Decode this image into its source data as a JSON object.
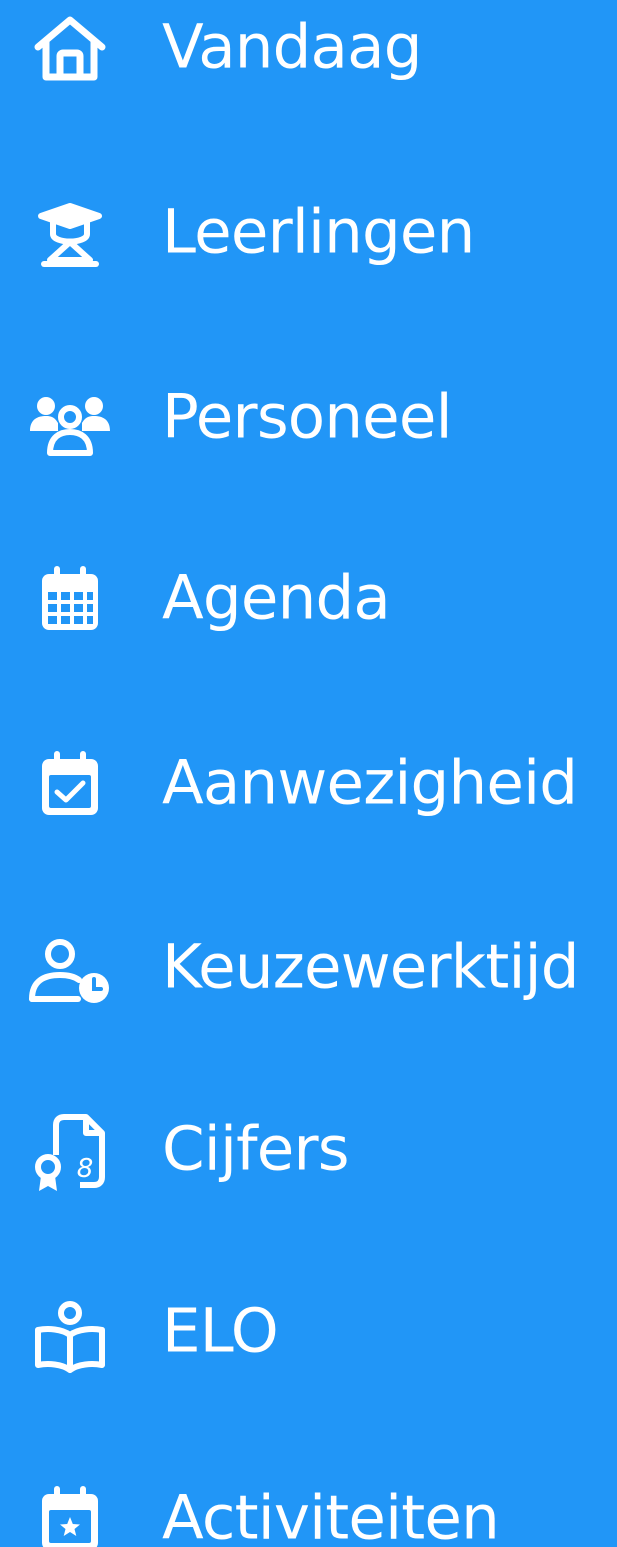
{
  "sidebar": {
    "background_color": "#2196f7",
    "text_color": "#ffffff",
    "items": [
      {
        "label": "Vandaag",
        "icon": "home-icon"
      },
      {
        "label": "Leerlingen",
        "icon": "student-graduate-icon"
      },
      {
        "label": "Personeel",
        "icon": "users-group-icon"
      },
      {
        "label": "Agenda",
        "icon": "calendar-grid-icon"
      },
      {
        "label": "Aanwezigheid",
        "icon": "calendar-check-icon"
      },
      {
        "label": "Keuzewerktijd",
        "icon": "user-clock-icon"
      },
      {
        "label": "Cijfers",
        "icon": "grade-document-icon"
      },
      {
        "label": "ELO",
        "icon": "book-reader-icon"
      },
      {
        "label": "Activiteiten",
        "icon": "calendar-star-icon"
      }
    ]
  }
}
